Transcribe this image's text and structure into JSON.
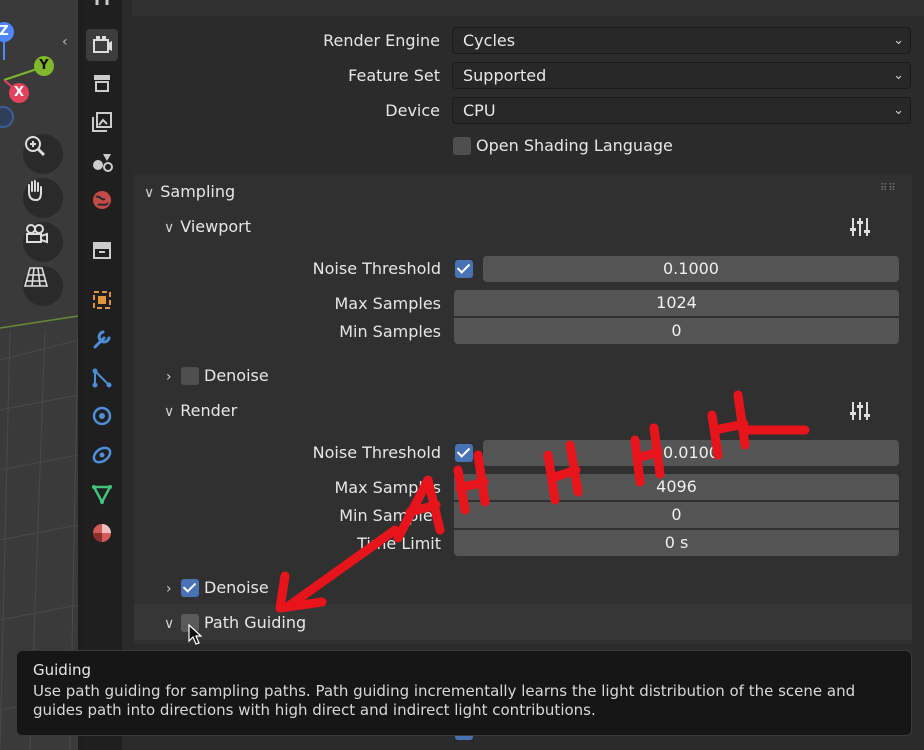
{
  "viewport": {
    "gizmo": {
      "z": "Z",
      "y": "Y",
      "x": "X"
    }
  },
  "tabs": [
    "render-properties",
    "output-properties",
    "view-layer-properties",
    "scene-properties",
    "world-properties",
    "collection-properties",
    "object-properties",
    "modifier-properties",
    "particles-properties",
    "physics-properties",
    "constraint-properties",
    "object-data-properties",
    "material-properties"
  ],
  "render": {
    "engine_label": "Render Engine",
    "engine_value": "Cycles",
    "feature_set_label": "Feature Set",
    "feature_set_value": "Supported",
    "device_label": "Device",
    "device_value": "CPU",
    "osl_label": "Open Shading Language"
  },
  "sampling": {
    "title": "Sampling",
    "viewport": {
      "title": "Viewport",
      "noise_threshold_label": "Noise Threshold",
      "noise_threshold_value": "0.1000",
      "max_samples_label": "Max Samples",
      "max_samples_value": "1024",
      "min_samples_label": "Min Samples",
      "min_samples_value": "0",
      "denoise_label": "Denoise"
    },
    "render": {
      "title": "Render",
      "noise_threshold_label": "Noise Threshold",
      "noise_threshold_value": "0.0100",
      "max_samples_label": "Max Samples",
      "max_samples_value": "4096",
      "min_samples_label": "Min Samples",
      "min_samples_value": "0",
      "time_limit_label": "Time Limit",
      "time_limit_value": "0 s",
      "denoise_label": "Denoise"
    },
    "path_guiding_label": "Path Guiding"
  },
  "tooltip": {
    "title": "Guiding",
    "body": "Use path guiding for sampling paths. Path guiding incrementally learns the light distribution of the scene and guides path into directions with high direct and indirect light contributions."
  },
  "annotation": {
    "text": "AHHHH",
    "color": "#e8141c"
  },
  "colors": {
    "accent": "#4772b3",
    "panel": "#2b2b2b",
    "field": "#545454"
  }
}
